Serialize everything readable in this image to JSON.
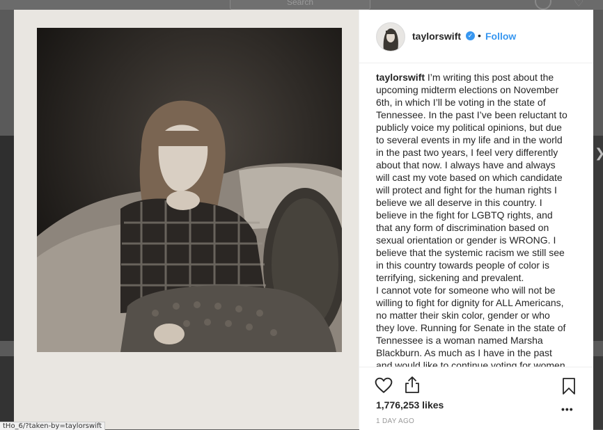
{
  "background": {
    "search_placeholder": "Search"
  },
  "post": {
    "username": "taylorswift",
    "follow_label": "Follow",
    "separator": "•",
    "caption_username": "taylorswift",
    "caption_lines": [
      "I’m writing this post about the",
      "upcoming midterm elections on November",
      "6th, in which I’ll be voting in the state of",
      "Tennessee. In the past I’ve been reluctant to",
      "publicly voice my political opinions, but due",
      "to several events in my life and in the world",
      "in the past two years, I feel very differently",
      "about that now. I always have and always",
      "will cast my vote based on which candidate",
      "will protect and fight for the human rights I",
      "believe we all deserve in this country. I",
      "believe in the fight for LGBTQ rights, and",
      "that any form of discrimination based on",
      "sexual orientation or gender is WRONG. I",
      "believe that the systemic racism we still see",
      "in this country towards people of color is",
      "terrifying, sickening and prevalent.",
      "I cannot vote for someone who will not be",
      "willing to fight for dignity for ALL Americans,",
      "no matter their skin color, gender or who",
      "they love. Running for Senate in the state of",
      "Tennessee is a woman named Marsha",
      "Blackburn. As much as I have in the past",
      "and would like to continue voting for women"
    ],
    "likes": "1,776,253 likes",
    "more": "•••",
    "timestamp": "1 DAY AGO"
  },
  "status_bar": {
    "url": "tHo_6/?taken-by=taylorswift"
  },
  "icons": {
    "like": "heart-icon",
    "share": "share-icon",
    "save": "bookmark-icon",
    "verified": "verified-badge-icon"
  },
  "colors": {
    "link": "#3897f0",
    "text": "#262626",
    "muted": "#999999"
  }
}
